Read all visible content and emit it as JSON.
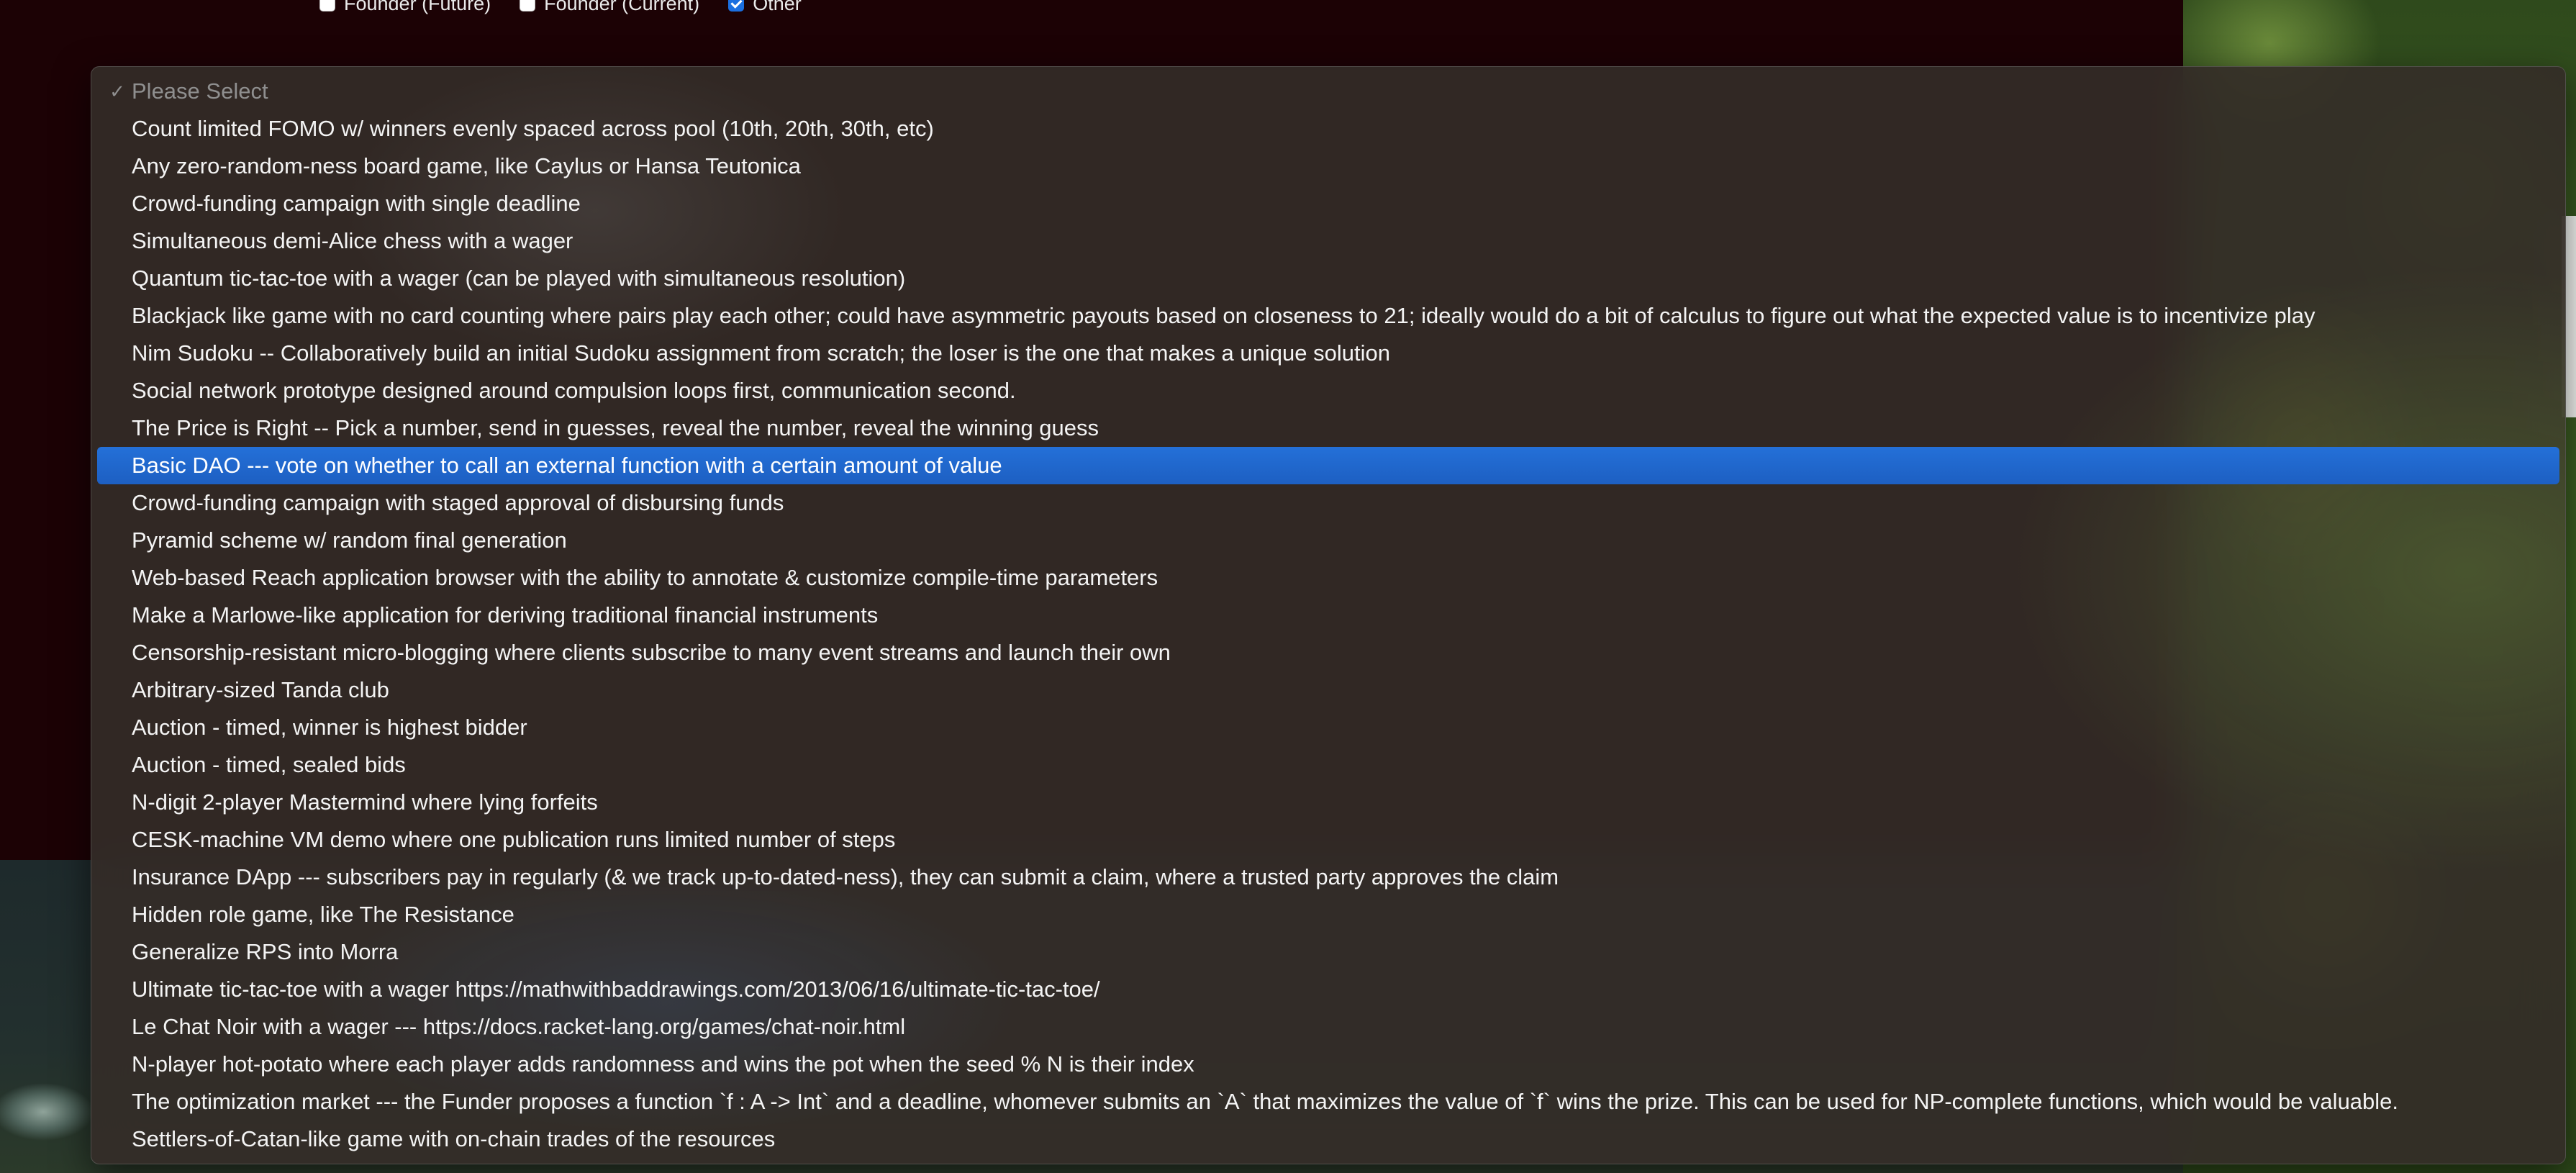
{
  "checkboxes": [
    {
      "label": "Founder (Future)",
      "checked": false
    },
    {
      "label": "Founder (Current)",
      "checked": false
    },
    {
      "label": "Other",
      "checked": true
    }
  ],
  "dropdown": {
    "placeholder": "Please Select",
    "checkmark": "✓",
    "selected_index": 10,
    "options": [
      "Please Select",
      "Count limited FOMO w/ winners evenly spaced across pool (10th, 20th, 30th, etc)",
      "Any zero-random-ness board game, like Caylus or Hansa Teutonica",
      "Crowd-funding campaign with single deadline",
      "Simultaneous demi-Alice chess with a wager",
      "Quantum tic-tac-toe with a wager (can be played with simultaneous resolution)",
      "Blackjack like game with no card counting where pairs play each other; could have asymmetric payouts based on closeness to 21; ideally would do a bit of calculus to figure out what the expected value is to incentivize play",
      "Nim Sudoku -- Collaboratively build an initial Sudoku assignment from scratch; the loser is the one that makes a unique solution",
      "Social network prototype designed around compulsion loops first, communication second.",
      "The Price is Right -- Pick a number, send in guesses, reveal the number, reveal the winning guess",
      "Basic DAO --- vote on whether to call an external function with a certain amount of value",
      "Crowd-funding campaign with staged approval of disbursing funds",
      "Pyramid scheme w/ random final generation",
      "Web-based Reach application browser with the ability to annotate & customize compile-time parameters",
      "Make a Marlowe-like application for deriving traditional financial instruments",
      "Censorship-resistant micro-blogging where clients subscribe to many event streams and launch their own",
      "Arbitrary-sized Tanda club",
      "Auction - timed, winner is highest bidder",
      "Auction - timed, sealed bids",
      "N-digit 2-player Mastermind where lying forfeits",
      "CESK-machine VM demo where one publication runs limited number of steps",
      "Insurance DApp --- subscribers pay in regularly (& we track up-to-dated-ness), they can submit a claim, where a trusted party approves the claim",
      "Hidden role game, like The Resistance",
      "Generalize RPS into Morra",
      "Ultimate tic-tac-toe with a wager https://mathwithbaddrawings.com/2013/06/16/ultimate-tic-tac-toe/",
      "Le Chat Noir with a wager --- https://docs.racket-lang.org/games/chat-noir.html",
      "N-player hot-potato where each player adds randomness and wins the pot when the seed % N is their index",
      "The optimization market --- the Funder proposes a function `f : A -> Int` and a deadline, whomever submits an `A` that maximizes the value of `f` wins the prize. This can be used for NP-complete functions, which would be valuable.",
      "Settlers-of-Catan-like game with on-chain trades of the resources"
    ]
  },
  "colors": {
    "page_background": "#1c0205",
    "selected_highlight": "#1f62c4",
    "option_text": "#f4f4f4",
    "placeholder_text": "#8f8f8f"
  }
}
